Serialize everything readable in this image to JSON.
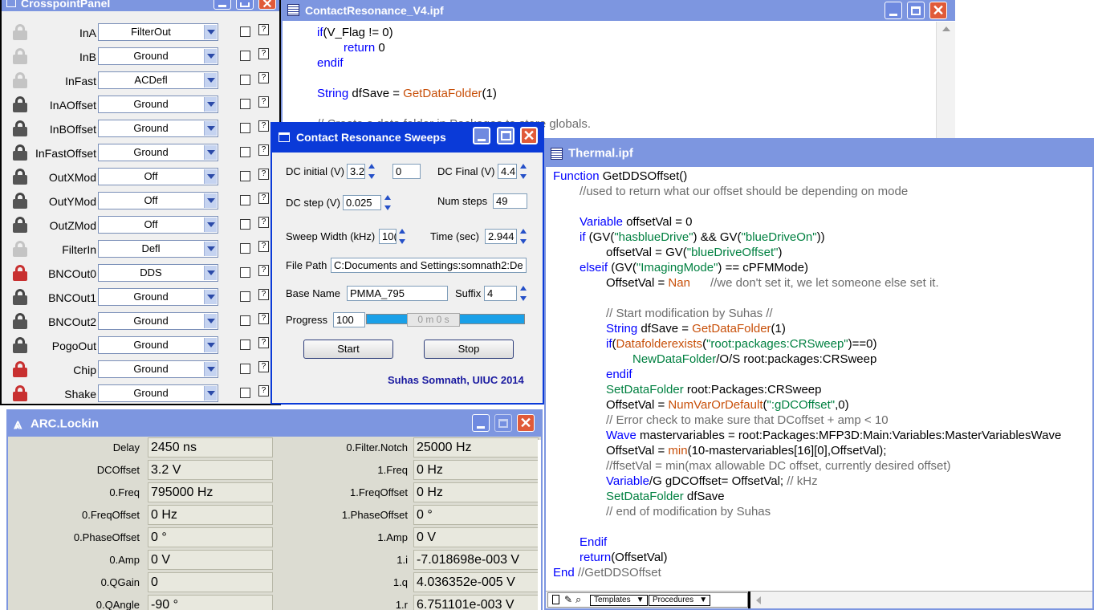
{
  "crosspoint": {
    "title": "CrosspointPanel",
    "rows": [
      {
        "label": "InA",
        "value": "FilterOut",
        "lock": "gray"
      },
      {
        "label": "InB",
        "value": "Ground",
        "lock": "gray"
      },
      {
        "label": "InFast",
        "value": "ACDefl",
        "lock": "gray"
      },
      {
        "label": "InAOffset",
        "value": "Ground",
        "lock": "dark"
      },
      {
        "label": "InBOffset",
        "value": "Ground",
        "lock": "dark"
      },
      {
        "label": "InFastOffset",
        "value": "Ground",
        "lock": "dark"
      },
      {
        "label": "OutXMod",
        "value": "Off",
        "lock": "dark"
      },
      {
        "label": "OutYMod",
        "value": "Off",
        "lock": "dark"
      },
      {
        "label": "OutZMod",
        "value": "Off",
        "lock": "dark"
      },
      {
        "label": "FilterIn",
        "value": "Defl",
        "lock": "gray"
      },
      {
        "label": "BNCOut0",
        "value": "DDS",
        "lock": "red"
      },
      {
        "label": "BNCOut1",
        "value": "Ground",
        "lock": "dark"
      },
      {
        "label": "BNCOut2",
        "value": "Ground",
        "lock": "dark"
      },
      {
        "label": "PogoOut",
        "value": "Ground",
        "lock": "dark"
      },
      {
        "label": "Chip",
        "value": "Ground",
        "lock": "red"
      },
      {
        "label": "Shake",
        "value": "Ground",
        "lock": "red"
      }
    ],
    "help_glyph": "?"
  },
  "contact_resonance_file": {
    "title": "ContactResonance_V4.ipf",
    "lines": [
      {
        "indent": 1,
        "parts": [
          [
            "kw",
            "if"
          ],
          [
            "",
            "(V_Flag != 0)"
          ]
        ]
      },
      {
        "indent": 2,
        "parts": [
          [
            "kw",
            "return"
          ],
          [
            "",
            " 0"
          ]
        ]
      },
      {
        "indent": 1,
        "parts": [
          [
            "kw",
            "endif"
          ]
        ]
      },
      {
        "indent": 0,
        "parts": []
      },
      {
        "indent": 1,
        "parts": [
          [
            "kw",
            "String"
          ],
          [
            "",
            " dfSave = "
          ],
          [
            "fn",
            "GetDataFolder"
          ],
          [
            "",
            "(1)"
          ]
        ]
      },
      {
        "indent": 0,
        "parts": []
      },
      {
        "indent": 1,
        "parts": [
          [
            "cm",
            "// Create a data folder in Packages to store globals."
          ]
        ]
      }
    ]
  },
  "thermal_file": {
    "title": "Thermal.ipf",
    "lines": [
      {
        "indent": 0,
        "parts": [
          [
            "kw",
            "Function"
          ],
          [
            "",
            " GetDDSOffset()"
          ]
        ]
      },
      {
        "indent": 1,
        "parts": [
          [
            "cm",
            "//used to return what our offset should be depending on mode"
          ]
        ]
      },
      {
        "indent": 0,
        "parts": []
      },
      {
        "indent": 1,
        "parts": [
          [
            "kw",
            "Variable"
          ],
          [
            "",
            " offsetVal = 0"
          ]
        ]
      },
      {
        "indent": 1,
        "parts": [
          [
            "kw",
            "if"
          ],
          [
            "",
            " (GV("
          ],
          [
            "str",
            "\"hasblueDrive\""
          ],
          [
            "",
            ") && GV("
          ],
          [
            "str",
            "\"blueDriveOn\""
          ],
          [
            "",
            "))"
          ]
        ]
      },
      {
        "indent": 2,
        "parts": [
          [
            "",
            "offsetVal = GV("
          ],
          [
            "str",
            "\"blueDriveOffset\""
          ],
          [
            "",
            ")"
          ]
        ]
      },
      {
        "indent": 1,
        "parts": [
          [
            "kw",
            "elseif"
          ],
          [
            "",
            " (GV("
          ],
          [
            "str",
            "\"ImagingMode\""
          ],
          [
            "",
            ") == cPFMMode)"
          ]
        ]
      },
      {
        "indent": 2,
        "parts": [
          [
            "",
            "OffsetVal = "
          ],
          [
            "fn",
            "Nan"
          ],
          [
            "",
            "      "
          ],
          [
            "cm",
            "//we don't set it, we let someone else set it."
          ]
        ]
      },
      {
        "indent": 0,
        "parts": []
      },
      {
        "indent": 2,
        "parts": [
          [
            "cm",
            "// Start modification by Suhas //"
          ]
        ]
      },
      {
        "indent": 2,
        "parts": [
          [
            "kw",
            "String"
          ],
          [
            "",
            " dfSave = "
          ],
          [
            "fn",
            "GetDataFolder"
          ],
          [
            "",
            "(1)"
          ]
        ]
      },
      {
        "indent": 2,
        "parts": [
          [
            "kw",
            "if"
          ],
          [
            "",
            "("
          ],
          [
            "fn",
            "Datafolderexists"
          ],
          [
            "",
            "("
          ],
          [
            "str",
            "\"root:packages:CRSweep\""
          ],
          [
            "",
            ")==0)"
          ]
        ]
      },
      {
        "indent": 3,
        "parts": [
          [
            "str",
            "NewDataFolder"
          ],
          [
            "",
            "/O/S root:packages:CRSweep"
          ]
        ]
      },
      {
        "indent": 2,
        "parts": [
          [
            "kw",
            "endif"
          ]
        ]
      },
      {
        "indent": 2,
        "parts": [
          [
            "str",
            "SetDataFolder"
          ],
          [
            "",
            " root:Packages:CRSweep"
          ]
        ]
      },
      {
        "indent": 2,
        "parts": [
          [
            "",
            "OffsetVal = "
          ],
          [
            "fn",
            "NumVarOrDefault"
          ],
          [
            "",
            "("
          ],
          [
            "str",
            "\":gDCOffset\""
          ],
          [
            "",
            ",0)"
          ]
        ]
      },
      {
        "indent": 2,
        "parts": [
          [
            "cm",
            "// Error check to make sure that DCoffset + amp < 10"
          ]
        ]
      },
      {
        "indent": 2,
        "parts": [
          [
            "kw",
            "Wave"
          ],
          [
            "",
            " mastervariables = root:Packages:MFP3D:Main:Variables:MasterVariablesWave"
          ]
        ]
      },
      {
        "indent": 2,
        "parts": [
          [
            "",
            "OffsetVal = "
          ],
          [
            "fn",
            "min"
          ],
          [
            "",
            "(10-mastervariables[16][0],OffsetVal);"
          ]
        ]
      },
      {
        "indent": 2,
        "parts": [
          [
            "cm",
            "//ffsetVal = min(max allowable DC offset, currently desired offset)"
          ]
        ]
      },
      {
        "indent": 2,
        "parts": [
          [
            "kw",
            "Variable"
          ],
          [
            "",
            "/G gDCOffset= OffsetVal; "
          ],
          [
            "cm",
            "// kHz"
          ]
        ]
      },
      {
        "indent": 2,
        "parts": [
          [
            "str",
            "SetDataFolder"
          ],
          [
            "",
            " dfSave"
          ]
        ]
      },
      {
        "indent": 2,
        "parts": [
          [
            "cm",
            "// end of modification by Suhas"
          ]
        ]
      },
      {
        "indent": 0,
        "parts": []
      },
      {
        "indent": 1,
        "parts": [
          [
            "kw",
            "Endif"
          ]
        ]
      },
      {
        "indent": 1,
        "parts": [
          [
            "kw",
            "return"
          ],
          [
            "",
            "(OffsetVal)"
          ]
        ]
      },
      {
        "indent": 0,
        "parts": [
          [
            "kw",
            "End"
          ],
          [
            "",
            " "
          ],
          [
            "cm",
            "//GetDDSOffset"
          ]
        ]
      }
    ],
    "footer": {
      "templates": "Templates",
      "procedures": "Procedures"
    }
  },
  "sweeps": {
    "title": "Contact Resonance Sweeps",
    "dc_initial_label": "DC initial (V)",
    "dc_initial_value": "3.2",
    "dc_initial_extra": "0",
    "dc_final_label": "DC Final (V)",
    "dc_final_value": "4.4",
    "dc_step_label": "DC step (V)",
    "dc_step_value": "0.025",
    "num_steps_label": "Num steps",
    "num_steps_value": "49",
    "sweep_width_label": "Sweep Width (kHz)",
    "sweep_width_value": "10(",
    "time_label": "Time (sec)",
    "time_value": "2.944",
    "file_path_label": "File Path",
    "file_path_value": "C:Documents and Settings:somnath2:De",
    "base_name_label": "Base Name",
    "base_name_value": "PMMA_795",
    "suffix_label": "Suffix",
    "suffix_value": "4",
    "progress_label": "Progress",
    "progress_value": "100",
    "progress_time": "0 m 0 s",
    "progress_fraction": 1.0,
    "start_label": "Start",
    "stop_label": "Stop",
    "credit": "Suhas Somnath, UIUC 2014",
    "credit_color": "#1a1aa0"
  },
  "lockin": {
    "title": "ARC.Lockin",
    "left": [
      {
        "label": "Delay",
        "value": "2450 ns"
      },
      {
        "label": "DCOffset",
        "value": "3.2 V"
      },
      {
        "label": "0.Freq",
        "value": "795000 Hz"
      },
      {
        "label": "0.FreqOffset",
        "value": "0 Hz"
      },
      {
        "label": "0.PhaseOffset",
        "value": "0 °"
      },
      {
        "label": "0.Amp",
        "value": "0 V"
      },
      {
        "label": "0.QGain",
        "value": "0"
      },
      {
        "label": "0.QAngle",
        "value": "-90 °"
      }
    ],
    "right": [
      {
        "label": "0.Filter.Notch",
        "value": "25000 Hz"
      },
      {
        "label": "1.Freq",
        "value": "0 Hz"
      },
      {
        "label": "1.FreqOffset",
        "value": "0 Hz"
      },
      {
        "label": "1.PhaseOffset",
        "value": "0 °"
      },
      {
        "label": "1.Amp",
        "value": "0 V"
      },
      {
        "label": "1.i",
        "value": "-7.018698e-003 V"
      },
      {
        "label": "1.q",
        "value": "4.036352e-005 V"
      },
      {
        "label": "1.r",
        "value": "6.751101e-003 V"
      }
    ]
  },
  "colors": {
    "title_active": "#0a3ad8",
    "title_inactive": "#7d96e0",
    "keyword": "#0000ff",
    "function": "#c8500a",
    "comment": "#6c6c6c",
    "string": "#008040",
    "close_button": "#e05a39"
  }
}
